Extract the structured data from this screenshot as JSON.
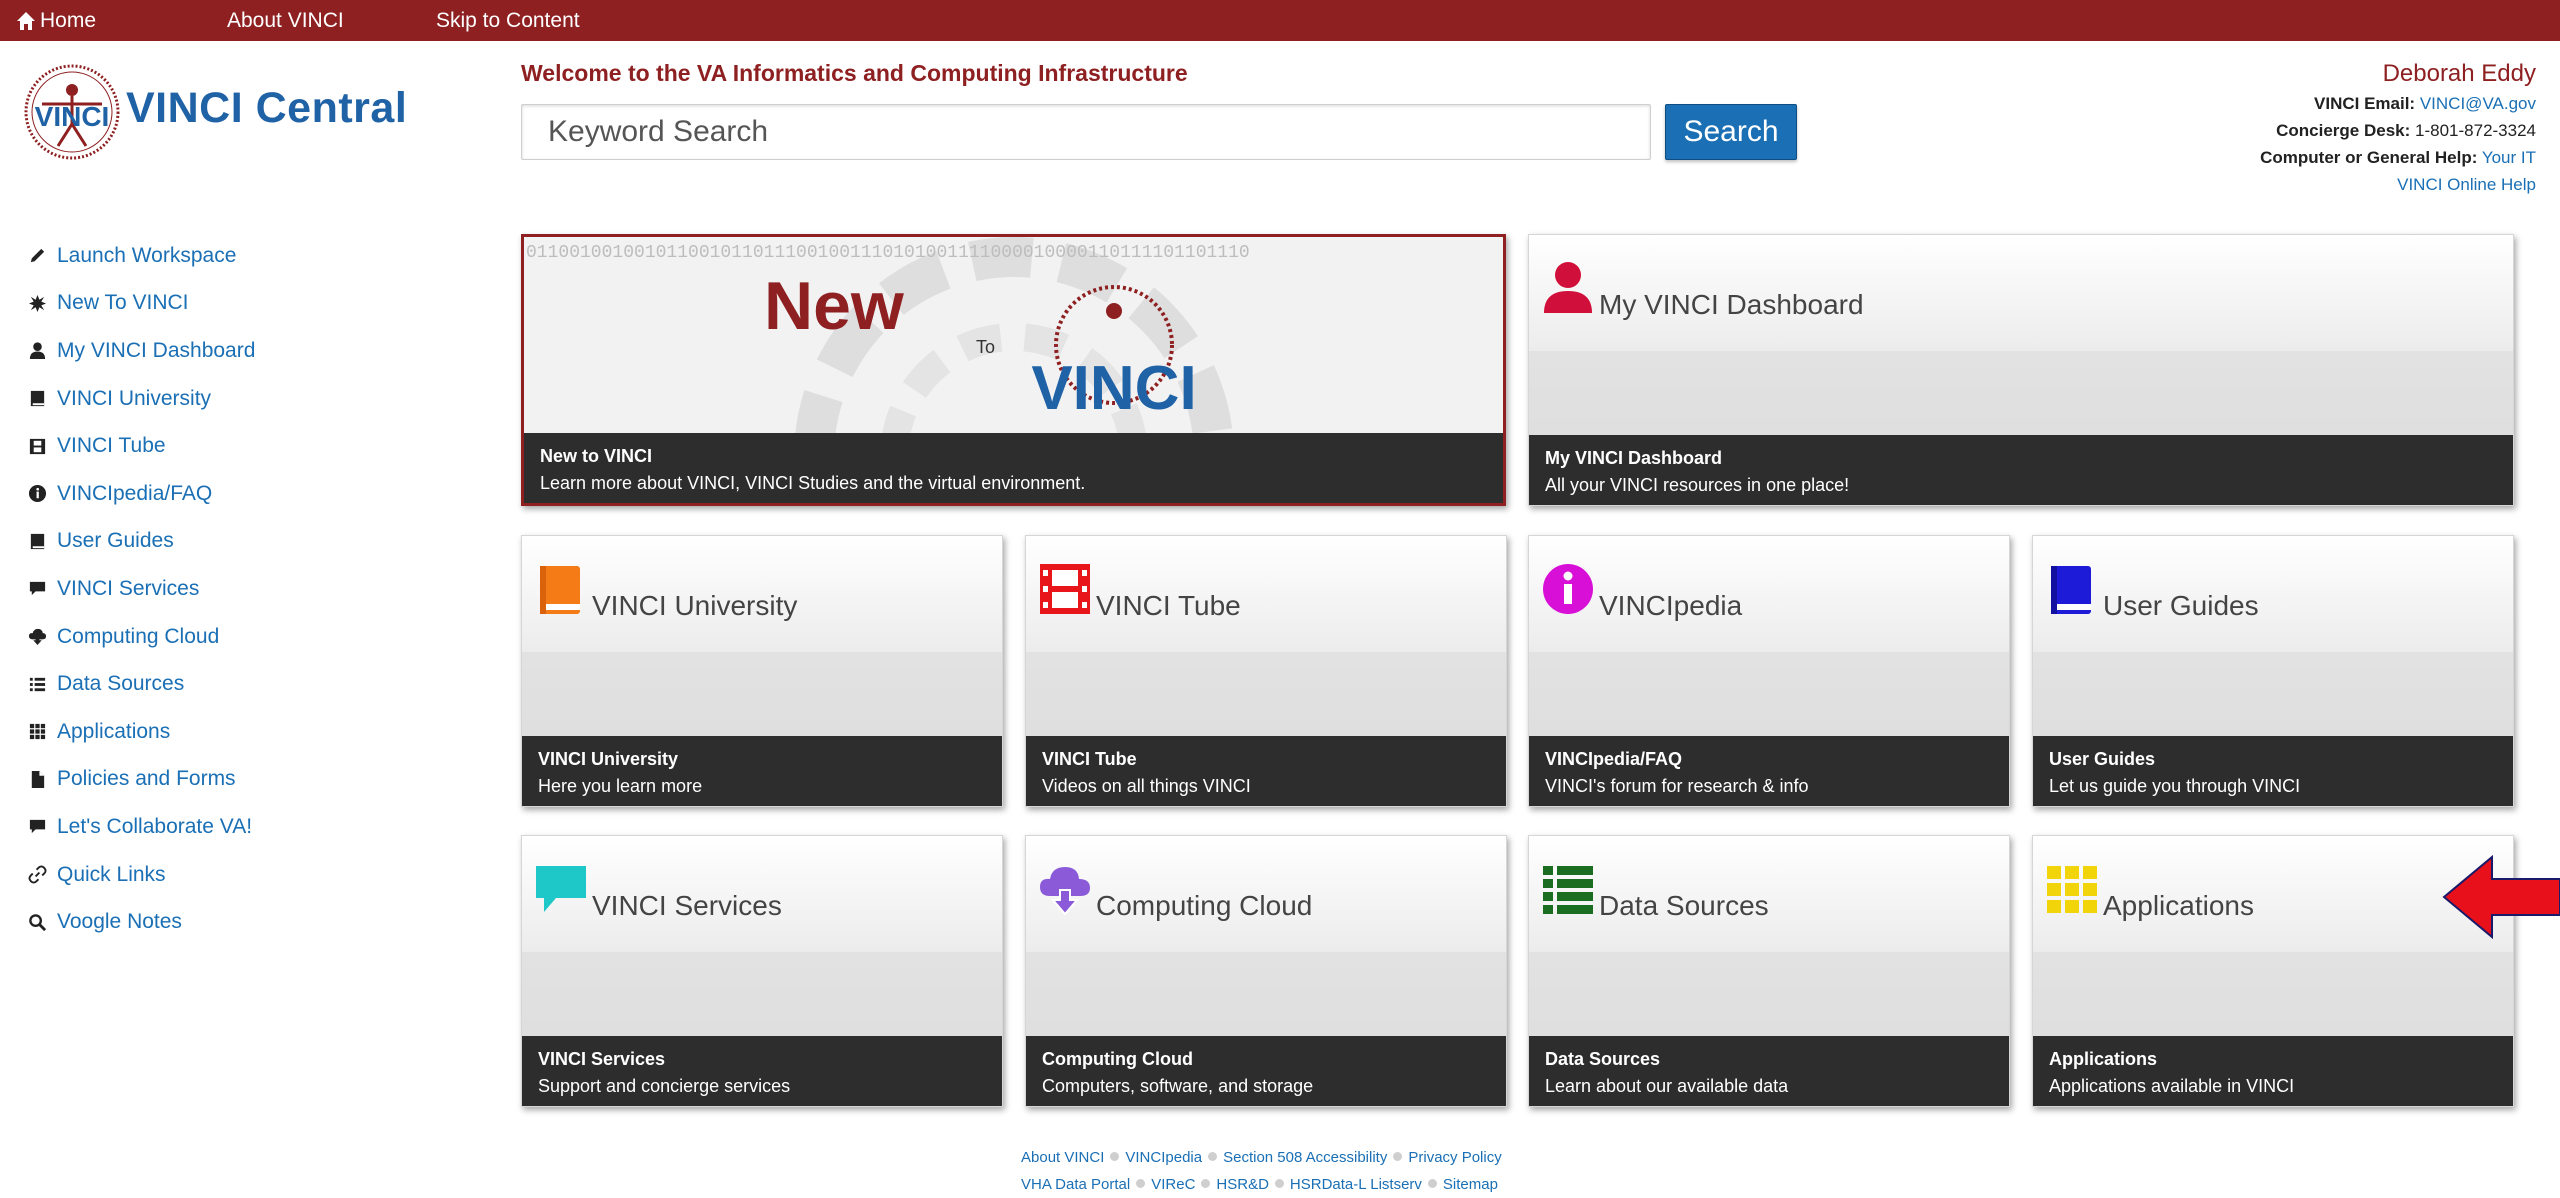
{
  "topbar": {
    "home": "Home",
    "about": "About VINCI",
    "skip": "Skip to Content"
  },
  "logo": {
    "text": "VINCI Central"
  },
  "header": {
    "welcome": "Welcome to the VA Informatics and Computing Infrastructure",
    "search_placeholder": "Keyword Search",
    "search_button": "Search"
  },
  "user": {
    "name": "Deborah Eddy",
    "email_label": "VINCI Email:",
    "email": "VINCI@VA.gov",
    "concierge_label": "Concierge Desk:",
    "concierge": "1-801-872-3324",
    "help_label": "Computer or General Help:",
    "help_link": "Your IT",
    "online_help": "VINCI Online Help"
  },
  "sidebar": {
    "items": [
      {
        "label": "Launch Workspace",
        "icon": "pencil-icon"
      },
      {
        "label": "New To VINCI",
        "icon": "starburst-icon"
      },
      {
        "label": "My VINCI Dashboard",
        "icon": "user-icon"
      },
      {
        "label": "VINCI University",
        "icon": "book-icon"
      },
      {
        "label": "VINCI Tube",
        "icon": "film-icon"
      },
      {
        "label": "VINCIpedia/FAQ",
        "icon": "info-icon"
      },
      {
        "label": "User Guides",
        "icon": "book-icon"
      },
      {
        "label": "VINCI Services",
        "icon": "comment-icon"
      },
      {
        "label": "Computing Cloud",
        "icon": "cloud-download-icon"
      },
      {
        "label": "Data Sources",
        "icon": "list-icon"
      },
      {
        "label": "Applications",
        "icon": "grid-icon"
      },
      {
        "label": "Policies and Forms",
        "icon": "document-icon"
      },
      {
        "label": "Let's Collaborate VA!",
        "icon": "comment-icon"
      },
      {
        "label": "Quick Links",
        "icon": "link-icon"
      },
      {
        "label": "Voogle Notes",
        "icon": "search-icon"
      }
    ]
  },
  "featured": {
    "new_to_vinci": {
      "banner_word_new": "New",
      "banner_word_to": "To",
      "banner_word_vinci": "VINCI",
      "banner_binary": "0110010010010110010110111001001110101001111000010000110111101101110",
      "caption_title": "New to VINCI",
      "caption_desc": "Learn more about VINCI, VINCI Studies and the virtual environment."
    },
    "dashboard": {
      "title": "My VINCI Dashboard",
      "caption_title": "My VINCI Dashboard",
      "caption_desc": "All your VINCI resources in one place!",
      "icon_color": "#d0103a"
    }
  },
  "tiles": [
    {
      "title": "VINCI University",
      "caption_title": "VINCI University",
      "caption_desc": "Here you learn more",
      "icon": "book-icon",
      "color": "#f47b16"
    },
    {
      "title": "VINCI Tube",
      "caption_title": "VINCI Tube",
      "caption_desc": "Videos on all things VINCI",
      "icon": "film-icon",
      "color": "#e8151a"
    },
    {
      "title": "VINCIpedia",
      "caption_title": "VINCIpedia/FAQ",
      "caption_desc": "VINCI's forum for research & info",
      "icon": "info-icon",
      "color": "#d70fd7"
    },
    {
      "title": "User Guides",
      "caption_title": "User Guides",
      "caption_desc": "Let us guide you through VINCI",
      "icon": "book-icon",
      "color": "#1d1ad8"
    },
    {
      "title": "VINCI Services",
      "caption_title": "VINCI Services",
      "caption_desc": "Support and concierge services",
      "icon": "comment-icon",
      "color": "#1ec8c8"
    },
    {
      "title": "Computing Cloud",
      "caption_title": "Computing Cloud",
      "caption_desc": "Computers, software, and storage",
      "icon": "cloud-download-icon",
      "color": "#8a5ad8"
    },
    {
      "title": "Data Sources",
      "caption_title": "Data Sources",
      "caption_desc": "Learn about our available data",
      "icon": "list-icon",
      "color": "#1b6e21"
    },
    {
      "title": "Applications",
      "caption_title": "Applications",
      "caption_desc": "Applications available in VINCI",
      "icon": "grid-icon",
      "color": "#f2d40a"
    }
  ],
  "annotation": {
    "arrow_color": "#e8101a"
  },
  "footer": {
    "row1": [
      "About VINCI",
      "VINCIpedia",
      "Section 508 Accessibility",
      "Privacy Policy"
    ],
    "row2": [
      "VHA Data Portal",
      "VIReC",
      "HSR&D",
      "HSRData-L Listserv",
      "Sitemap"
    ]
  },
  "colors": {
    "brand_red": "#8e2021",
    "link_blue": "#1a6fb5",
    "caption_bg": "#2d2d2d"
  }
}
